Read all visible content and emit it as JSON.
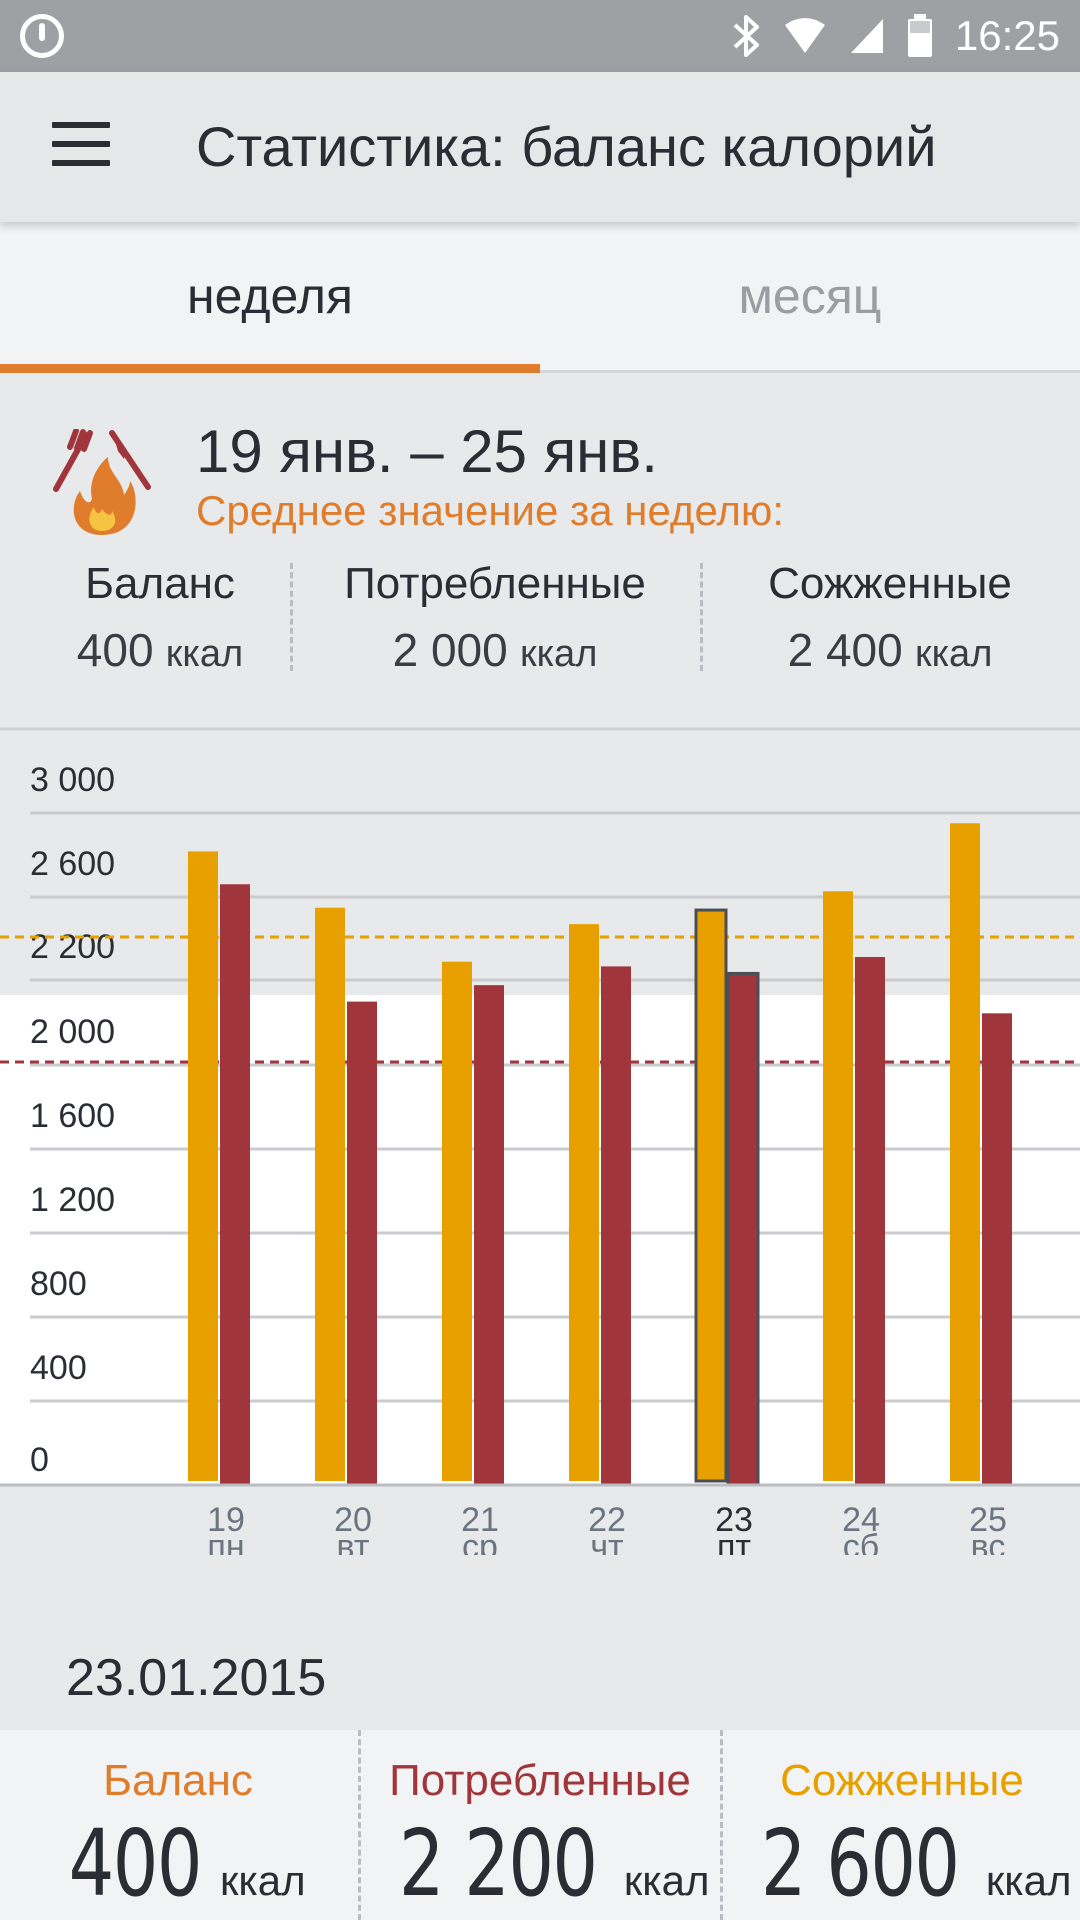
{
  "status_bar": {
    "time": "16:25",
    "icons": [
      "app-logo-icon",
      "bluetooth-icon",
      "wifi-icon",
      "signal-icon",
      "battery-icon"
    ]
  },
  "app_bar": {
    "title": "Статистика: баланс калорий",
    "menu_icon": "hamburger-menu-icon"
  },
  "tabs": [
    {
      "label": "неделя",
      "selected": true
    },
    {
      "label": "месяц",
      "selected": false
    }
  ],
  "summary": {
    "range": "19 янв. – 25 янв.",
    "avg_label": "Среднее значение за неделю:",
    "stats": [
      {
        "label": "Баланс",
        "value": "400",
        "unit": "ккал"
      },
      {
        "label": "Потребленные",
        "value": "2 000",
        "unit": "ккал"
      },
      {
        "label": "Сожженные",
        "value": "2 400",
        "unit": "ккал"
      }
    ]
  },
  "chart_data": {
    "type": "bar",
    "y_ticks": [
      {
        "value": 0,
        "label": "0"
      },
      {
        "value": 400,
        "label": "400"
      },
      {
        "value": 800,
        "label": "800"
      },
      {
        "value": 1200,
        "label": "1 200"
      },
      {
        "value": 1600,
        "label": "1 600"
      },
      {
        "value": 2000,
        "label": "2 000"
      },
      {
        "value": 2200,
        "label": "2 200"
      },
      {
        "value": 2600,
        "label": "2 600"
      },
      {
        "value": 3000,
        "label": "3 000"
      }
    ],
    "categories": [
      {
        "day": "19",
        "weekday": "пн"
      },
      {
        "day": "20",
        "weekday": "вт"
      },
      {
        "day": "21",
        "weekday": "ср"
      },
      {
        "day": "22",
        "weekday": "чт"
      },
      {
        "day": "23",
        "weekday": "пт"
      },
      {
        "day": "24",
        "weekday": "сб"
      },
      {
        "day": "25",
        "weekday": "вс"
      }
    ],
    "series": [
      {
        "key": "burned",
        "color": "#e8a000",
        "values": [
          2700,
          2460,
          2230,
          2390,
          2450,
          2530,
          2820
        ]
      },
      {
        "key": "consumed",
        "color": "#a0363c",
        "values": [
          2560,
          2060,
          2130,
          2210,
          2180,
          2250,
          2010
        ]
      }
    ],
    "reference_lines": [
      {
        "value": 2270,
        "color": "#e8a000"
      },
      {
        "value": 2000,
        "color": "#a0363c"
      }
    ],
    "selected_index": 4,
    "ylim": [
      0,
      3000
    ]
  },
  "detail": {
    "date": "23.01.2015",
    "balance": {
      "label": "Баланс",
      "value": "400",
      "unit": "ккал",
      "color": "#e07d2c"
    },
    "consumed": {
      "label": "Потребленные",
      "value": "2 200",
      "unit": "ккал",
      "color": "#a0363c"
    },
    "burned": {
      "label": "Сожженные",
      "value": "2 600",
      "unit": "ккал",
      "color": "#e8a000"
    }
  }
}
